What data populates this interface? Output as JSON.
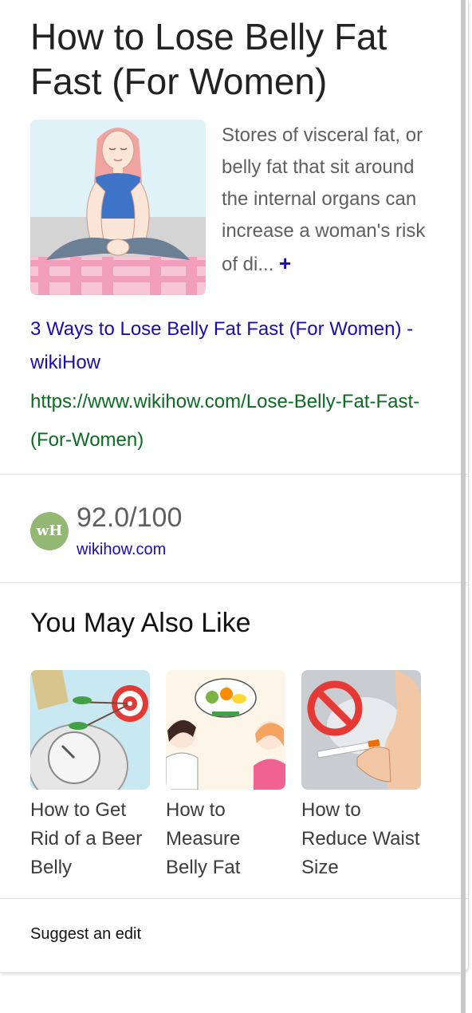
{
  "panel": {
    "title": "How to Lose Belly Fat Fast (For Women)",
    "snippet": "Stores of visceral fat, or belly fat that sit around the internal organs can increase a woman's risk of di...",
    "expand_symbol": "+",
    "source_title": "3 Ways to Lose Belly Fat Fast (For Women) - wikiHow",
    "source_url": "https://www.wikihow.com/Lose-Belly-Fat-Fast-(For-Women)"
  },
  "rating": {
    "badge_text": "wH",
    "score": "92.0/100",
    "domain": "wikihow.com"
  },
  "related": {
    "heading": "You May Also Like",
    "items": [
      {
        "label": "How to Get Rid of a Beer Belly",
        "icon": "scale-target-icon"
      },
      {
        "label": "How to Measure Belly Fat",
        "icon": "doctor-patient-icon"
      },
      {
        "label": "How to Reduce Waist Size",
        "icon": "no-smoking-icon"
      }
    ]
  },
  "footer": {
    "suggest_label": "Suggest an edit"
  }
}
